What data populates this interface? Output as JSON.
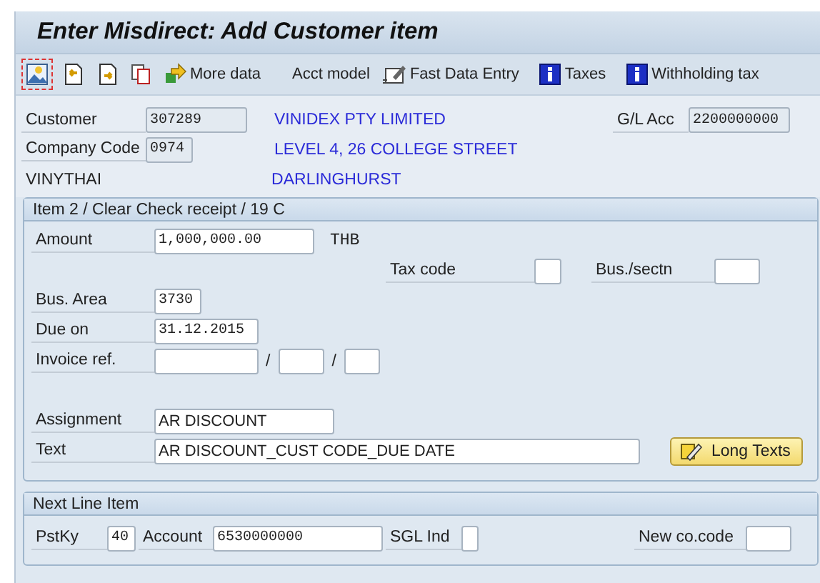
{
  "window": {
    "title": "Enter Misdirect: Add Customer item"
  },
  "toolbar": [
    {
      "kind": "overview",
      "focused": true
    },
    {
      "kind": "previous",
      "focused": false
    },
    {
      "kind": "next",
      "focused": false
    },
    {
      "kind": "copy",
      "focused": false
    },
    {
      "kind": "more",
      "label": "More data",
      "focused": false
    },
    {
      "kind": "text",
      "label": "Acct model",
      "focused": false
    },
    {
      "kind": "fast",
      "label": "Fast Data Entry",
      "focused": false
    },
    {
      "kind": "info",
      "label": "Taxes",
      "focused": false
    },
    {
      "kind": "info",
      "label": "Withholding tax",
      "focused": false
    }
  ],
  "header": {
    "customer": {
      "label": "Customer",
      "value": "307289"
    },
    "company_code": {
      "label": "Company Code",
      "value": "0974"
    },
    "customer_short_name": "VINYTHAI",
    "address": [
      "VINIDEX PTY LIMITED",
      "LEVEL 4, 26 COLLEGE STREET",
      "DARLINGHURST"
    ],
    "gl_account": {
      "label": "G/L Acc",
      "value": "2200000000"
    }
  },
  "item": {
    "title": "Item 2 / Clear Check receipt / 19 C",
    "amount": {
      "label": "Amount",
      "value": "1,000,000.00",
      "currency": "THB"
    },
    "tax_code": {
      "label": "Tax code"
    },
    "business_section": {
      "label": "Bus./sectn"
    },
    "business_area": {
      "label": "Bus. Area",
      "value": "3730"
    },
    "due_on": {
      "label": "Due on",
      "value": "31.12.2015"
    },
    "invoice_ref": {
      "label": "Invoice ref.",
      "separators": [
        "/",
        "/"
      ]
    },
    "assignment": {
      "label": "Assignment",
      "value": "AR DISCOUNT"
    },
    "text": {
      "label": "Text",
      "value": "AR DISCOUNT_CUST CODE_DUE DATE"
    },
    "long_texts_button": "Long Texts"
  },
  "next_line_item": {
    "title": "Next Line Item",
    "posting_key": {
      "label": "PstKy",
      "value": "40"
    },
    "account": {
      "label": "Account",
      "value": "6530000000"
    },
    "sgl_ind": {
      "label": "SGL Ind"
    },
    "new_company_code": {
      "label": "New co.code"
    }
  }
}
